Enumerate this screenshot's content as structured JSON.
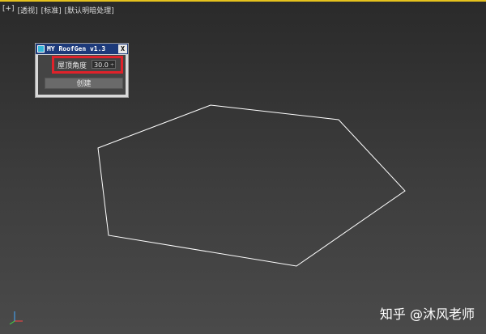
{
  "viewport": {
    "labels": [
      "[+]",
      "[透视]",
      "[标准]",
      "[默认明暗处理]"
    ],
    "shape_name": "hexagon-spline"
  },
  "panel": {
    "title": "MY RoofGen v1.3",
    "close_label": "X",
    "roof_angle_label": "屋顶角度",
    "roof_angle_value": "30.0",
    "spinner_symbol": "÷",
    "create_label": "创建"
  },
  "watermark": {
    "text": "知乎 @沐风老师"
  },
  "colors": {
    "highlight": "#e0222a",
    "title_bar": "#1d3a7a",
    "viewport_border": "#e6c21d"
  },
  "icons": [
    "app-icon",
    "close-icon",
    "spinner-icon",
    "axis-gizmo-icon"
  ]
}
